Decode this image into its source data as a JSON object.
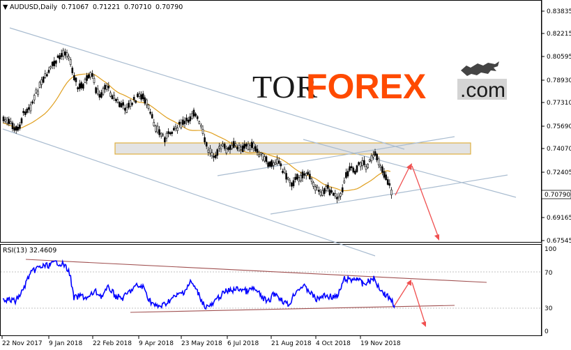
{
  "header": {
    "symbol": "AUDUSD,Daily",
    "open": "0.71067",
    "high": "0.71221",
    "low": "0.70710",
    "close": "0.70790"
  },
  "price_axis": {
    "ticks": [
      "0.83835",
      "0.82215",
      "0.80595",
      "0.78930",
      "0.77310",
      "0.75690",
      "0.74070",
      "0.72405",
      "0.70790",
      "0.69165",
      "0.67545"
    ],
    "current_price": "0.70790"
  },
  "rsi": {
    "label": "RSI(13) 32.4609",
    "ticks": [
      "100",
      "70",
      "30",
      "0"
    ]
  },
  "time_axis": {
    "labels": [
      "22 Nov 2017",
      "9 Jan 2018",
      "22 Feb 2018",
      "9 Apr 2018",
      "23 May 2018",
      "6 Jul 2018",
      "21 Aug 2018",
      "4 Oct 2018",
      "19 Nov 2018"
    ]
  },
  "logo": {
    "part1": "TOR",
    "part2": "FOREX",
    "part3": ".com"
  },
  "colors": {
    "up_candle": "#ffffff",
    "down_candle": "#000000",
    "ma_fast": "#e0a020",
    "ma_slow": "#20a090",
    "channel": "#a9bcd0",
    "resistance_zone": "#e8e8e8",
    "zone_border": "#e0b040",
    "rsi_line": "#0000ff",
    "rsi_trend": "#a05050",
    "arrow": "#f05050",
    "logo_accent": "#ff4a00"
  },
  "chart_data": {
    "type": "candlestick",
    "ylim": [
      0.6735,
      0.8435
    ],
    "rsi_ylim": [
      0,
      100
    ],
    "last_close": 0.7079
  }
}
